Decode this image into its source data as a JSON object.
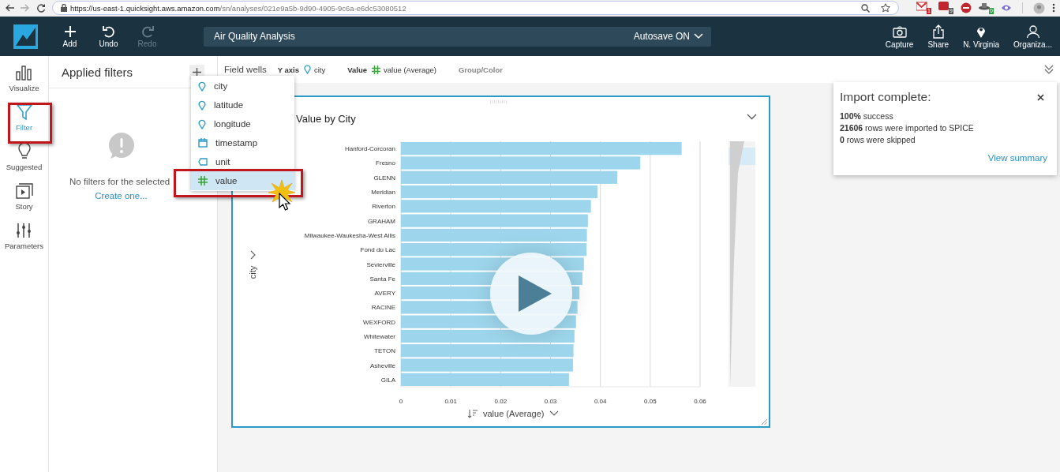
{
  "browser": {
    "url_host": "https://us-east-1.quicksight.aws.amazon.com",
    "url_path": "/sn/analyses/021e9a5b-9d90-4905-9c6a-e6dc53080512",
    "extensions": [
      {
        "kind": "mail",
        "badge": "1",
        "color": "#c0262d"
      },
      {
        "kind": "news",
        "badge": "9",
        "color": "#555555"
      },
      {
        "kind": "stop"
      },
      {
        "kind": "hat",
        "badge": "0",
        "color": "#2f9e44"
      },
      {
        "kind": "eye"
      }
    ]
  },
  "header": {
    "actions": [
      {
        "label": "Add",
        "kind": "add",
        "disabled": false
      },
      {
        "label": "Undo",
        "kind": "undo",
        "disabled": false
      },
      {
        "label": "Redo",
        "kind": "redo",
        "disabled": true
      }
    ],
    "title": "Air Quality Analysis",
    "autosave": "Autosave ON",
    "tools": [
      {
        "label": "Capture",
        "kind": "camera"
      },
      {
        "label": "Share",
        "kind": "share"
      },
      {
        "label": "N. Virginia",
        "kind": "pin"
      },
      {
        "label": "Organiza...",
        "kind": "user"
      }
    ]
  },
  "rail": [
    {
      "label": "Visualize",
      "kind": "bars",
      "selected": false
    },
    {
      "label": "Filter",
      "kind": "funnel",
      "selected": true
    },
    {
      "label": "Suggested",
      "kind": "bulb",
      "selected": false
    },
    {
      "label": "Story",
      "kind": "story",
      "selected": false
    },
    {
      "label": "Parameters",
      "kind": "sliders",
      "selected": false
    }
  ],
  "filters": {
    "title": "Applied filters",
    "empty_message": "No filters for the selected",
    "create_link": "Create one..."
  },
  "field_wells": {
    "label": "Field wells",
    "wells": [
      {
        "label": "Y axis",
        "kind": "dimension",
        "field": "city"
      },
      {
        "label": "Value",
        "kind": "measure",
        "field": "value (Average)"
      },
      {
        "label": "Group/Color",
        "kind": "empty"
      }
    ]
  },
  "field_menu": [
    {
      "label": "city",
      "kind": "geo",
      "selected": false
    },
    {
      "label": "latitude",
      "kind": "geo",
      "selected": false
    },
    {
      "label": "longitude",
      "kind": "geo",
      "selected": false
    },
    {
      "label": "timestamp",
      "kind": "date",
      "selected": false
    },
    {
      "label": "unit",
      "kind": "text",
      "selected": false
    },
    {
      "label": "value",
      "kind": "number",
      "selected": true
    }
  ],
  "visual": {
    "title": "Value by City",
    "chart_data": {
      "type": "bar",
      "orientation": "horizontal",
      "xlabel": "value (Average)",
      "ylabel": "city",
      "grid": true,
      "categories": [
        "Hanford-Corcoran",
        "Fresno",
        "GLENN",
        "Meridian",
        "Riverton",
        "GRAHAM",
        "Milwaukee-Waukesha-West Allis",
        "Fond du Lac",
        "Sevierville",
        "Santa Fe",
        "AVERY",
        "RACINE",
        "WEXFORD",
        "Whitewater",
        "TETON",
        "Asheville",
        "GILA"
      ],
      "series": [
        {
          "color": "#9dd6ec",
          "values": [
            0.0563,
            0.048,
            0.0434,
            0.0394,
            0.0381,
            0.0375,
            0.0373,
            0.0372,
            0.0367,
            0.0364,
            0.0358,
            0.0354,
            0.0351,
            0.0348,
            0.0346,
            0.0345,
            0.0337
          ]
        }
      ],
      "xlim": [
        0,
        0.06
      ],
      "xticks": [
        {
          "value": 0,
          "label": "0"
        },
        {
          "value": 0.01,
          "label": "0.01"
        },
        {
          "value": 0.02,
          "label": "0.02"
        },
        {
          "value": 0.03,
          "label": "0.03"
        },
        {
          "value": 0.04,
          "label": "0.04"
        },
        {
          "value": 0.05,
          "label": "0.05"
        },
        {
          "value": 0.06,
          "label": "0.06"
        }
      ]
    }
  },
  "toast": {
    "title": "Import complete:",
    "lines": [
      "**100%** success",
      "**21606** rows were imported to SPICE",
      "**0** rows were skipped"
    ],
    "link": "View summary"
  }
}
